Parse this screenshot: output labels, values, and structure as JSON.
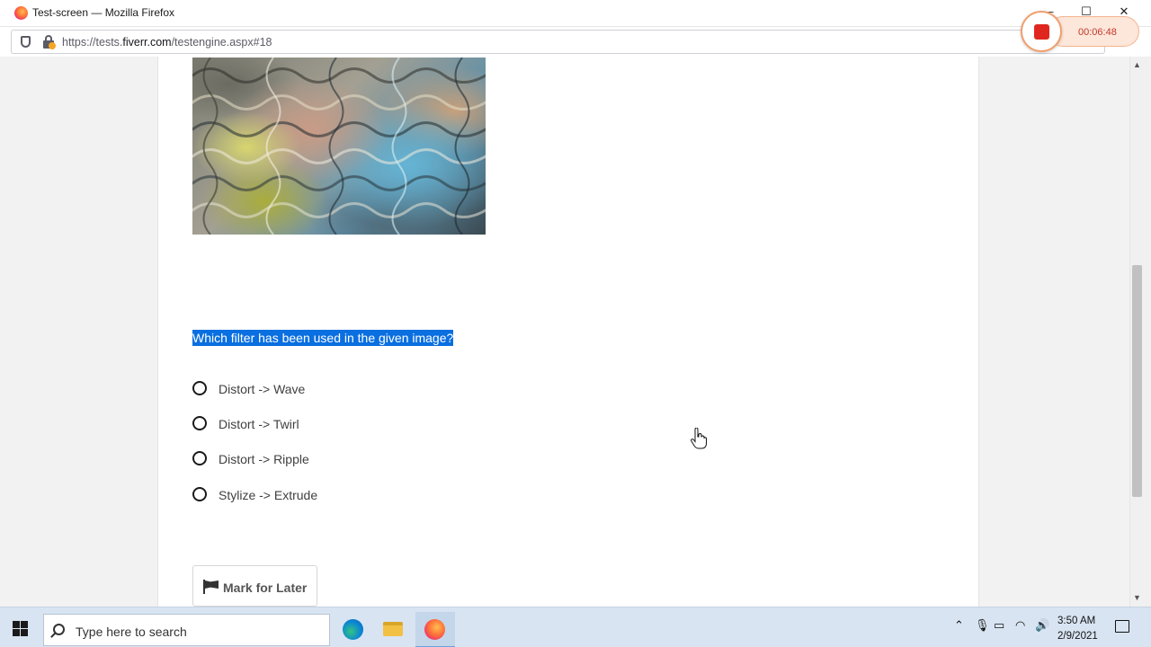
{
  "window": {
    "title": "Test-screen — Mozilla Firefox",
    "controls": {
      "minimize": "—",
      "maximize": "☐",
      "close": "✕"
    }
  },
  "urlbar": {
    "url_prefix": "https://tests.",
    "url_domain": "fiverr.com",
    "url_path": "/testengine.aspx#18"
  },
  "recorder": {
    "time": "00:06:48"
  },
  "test": {
    "question": "Which filter has been used in the given image?",
    "options": [
      {
        "label": "Distort -> Wave"
      },
      {
        "label": "Distort -> Twirl"
      },
      {
        "label": "Distort -> Ripple"
      },
      {
        "label": "Stylize -> Extrude"
      }
    ],
    "mark_button": "Mark for Later"
  },
  "taskbar": {
    "search_placeholder": "Type here to search",
    "time": "3:50 AM",
    "date": "2/9/2021",
    "pinned_apps": [
      "edge-icon",
      "file-explorer-icon",
      "firefox-icon"
    ],
    "active_app": "firefox-icon",
    "tray_icons": [
      "chevron-up-icon",
      "microphone-icon",
      "battery-icon",
      "wifi-icon",
      "volume-icon"
    ]
  },
  "colors": {
    "selection": "#0a6fe0",
    "recorder_stop": "#e0271f",
    "taskbar": "#d8e4f2"
  }
}
